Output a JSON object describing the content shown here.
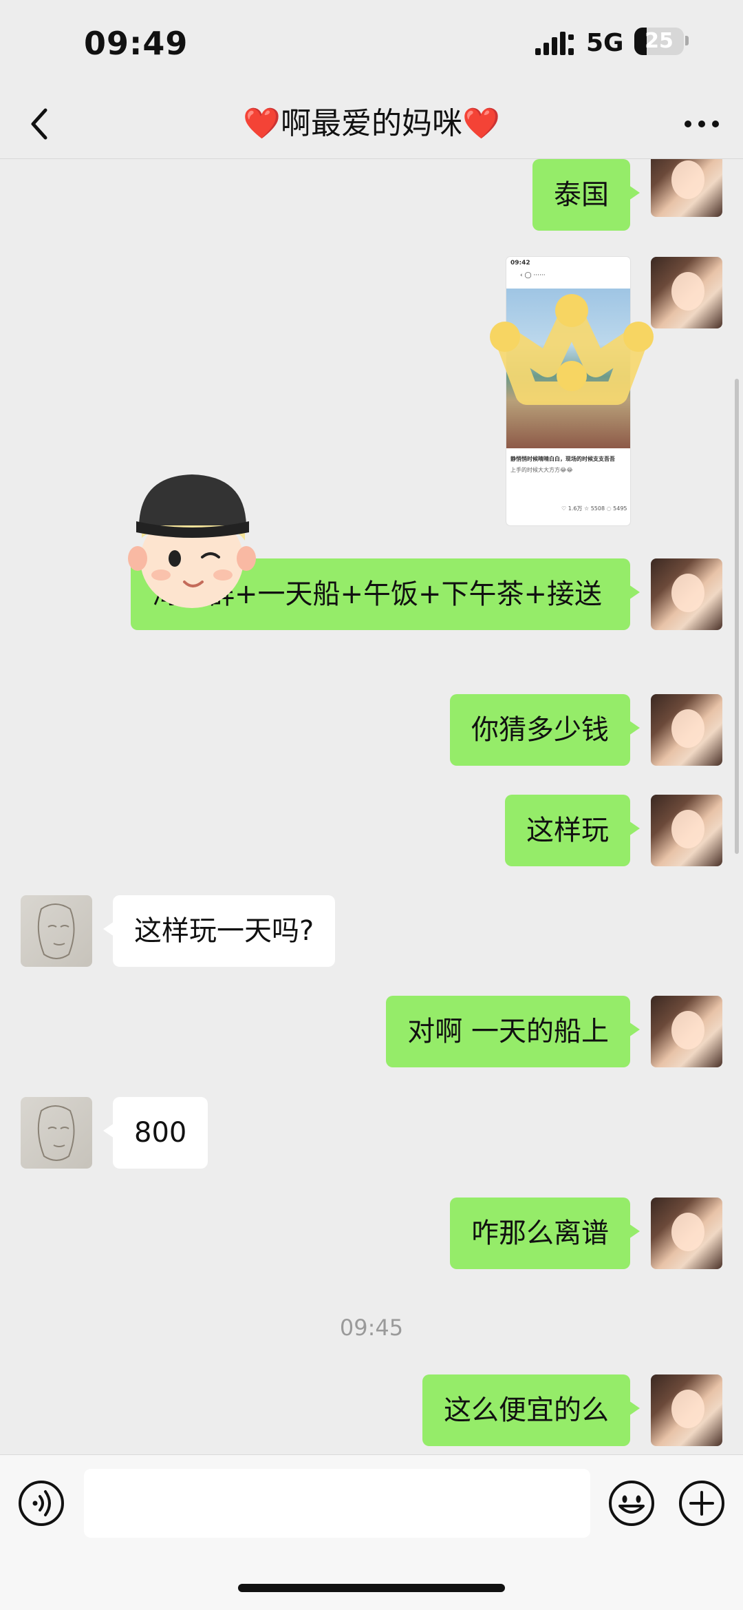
{
  "status_bar": {
    "time": "09:49",
    "network": "5G",
    "battery": "25",
    "battery_level": 0.25
  },
  "header": {
    "title": "啊最爱的妈咪",
    "heart_left": "❤️",
    "heart_right": "❤️"
  },
  "messages": {
    "m1": "泰国",
    "m3": "海岛群+一天船+午饭+下午茶+接送",
    "m4": "你猜多少钱",
    "m5": "这样玩",
    "m6": "这样玩一天吗?",
    "m7": "对啊 一天的船上",
    "m8": "800",
    "m9": "咋那么离谱",
    "time_divider": "09:45",
    "m10": "这么便宜的么"
  },
  "shared_screenshot": {
    "time": "09:42",
    "caption": "静悄悄时候晴晴白白，现场的时候支支吾吾",
    "sub": "上手的时候大大方方😂😂",
    "likes": "1.6万",
    "stars": "5508",
    "comments": "5495"
  },
  "colors": {
    "bubble_me": "#95ec69",
    "bubble_other": "#ffffff",
    "background": "#ededed",
    "heart": "#e8232b"
  },
  "icons": {
    "back": "chevron-left-icon",
    "more": "more-dots-icon",
    "voice": "voice-icon",
    "emoji": "emoji-icon",
    "plus": "plus-icon"
  }
}
